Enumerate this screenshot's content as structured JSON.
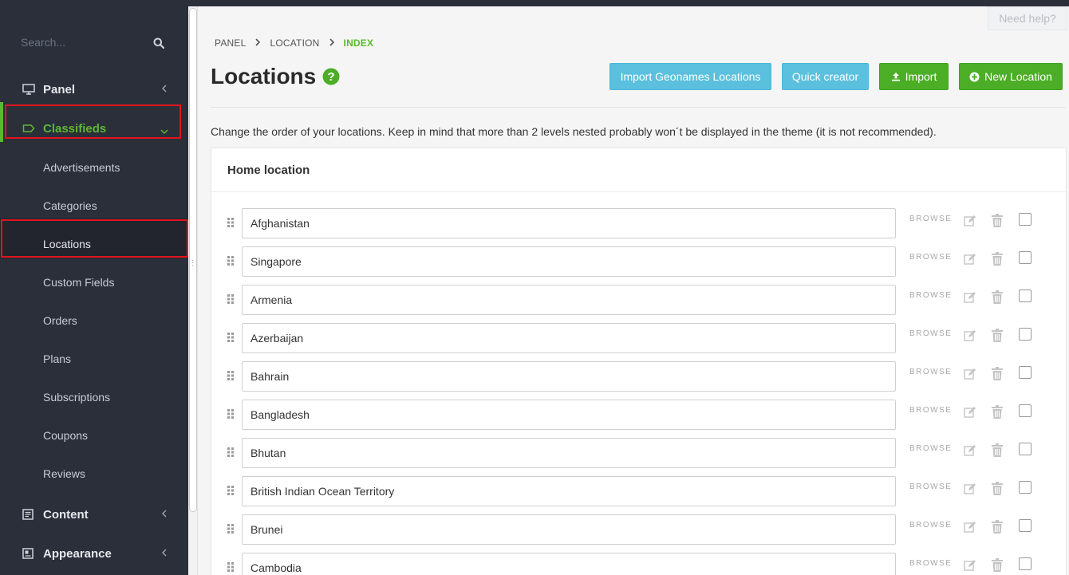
{
  "sidebar": {
    "search_placeholder": "Search...",
    "items": [
      {
        "label": "Panel",
        "type": "top",
        "icon": "monitor-icon"
      },
      {
        "label": "Classifieds",
        "type": "top",
        "icon": "tag-icon",
        "active": true
      },
      {
        "label": "Advertisements",
        "type": "sub"
      },
      {
        "label": "Categories",
        "type": "sub"
      },
      {
        "label": "Locations",
        "type": "sub",
        "current": true
      },
      {
        "label": "Custom Fields",
        "type": "sub"
      },
      {
        "label": "Orders",
        "type": "sub"
      },
      {
        "label": "Plans",
        "type": "sub"
      },
      {
        "label": "Subscriptions",
        "type": "sub"
      },
      {
        "label": "Coupons",
        "type": "sub"
      },
      {
        "label": "Reviews",
        "type": "sub"
      },
      {
        "label": "Content",
        "type": "top",
        "icon": "document-icon"
      },
      {
        "label": "Appearance",
        "type": "top",
        "icon": "image-icon"
      }
    ]
  },
  "header": {
    "help_label": "Need help?",
    "breadcrumb": [
      "PANEL",
      "LOCATION",
      "INDEX"
    ],
    "title": "Locations"
  },
  "toolbar": {
    "import_geonames_label": "Import Geonames Locations",
    "quick_creator_label": "Quick creator",
    "import_label": "Import",
    "new_location_label": "New Location"
  },
  "description": "Change the order of your locations. Keep in mind that more than 2 levels nested probably won´t be displayed in the theme (it is not recommended).",
  "panel": {
    "heading": "Home location",
    "browse_label": "BROWSE",
    "locations": [
      "Afghanistan",
      "Singapore",
      "Armenia",
      "Azerbaijan",
      "Bahrain",
      "Bangladesh",
      "Bhutan",
      "British Indian Ocean Territory",
      "Brunei",
      "Cambodia"
    ]
  },
  "colors": {
    "sidebar_bg": "#2b2f3a",
    "accent_green": "#5cb82e",
    "info_blue": "#5bc0de",
    "highlight_red": "#e3141c"
  }
}
